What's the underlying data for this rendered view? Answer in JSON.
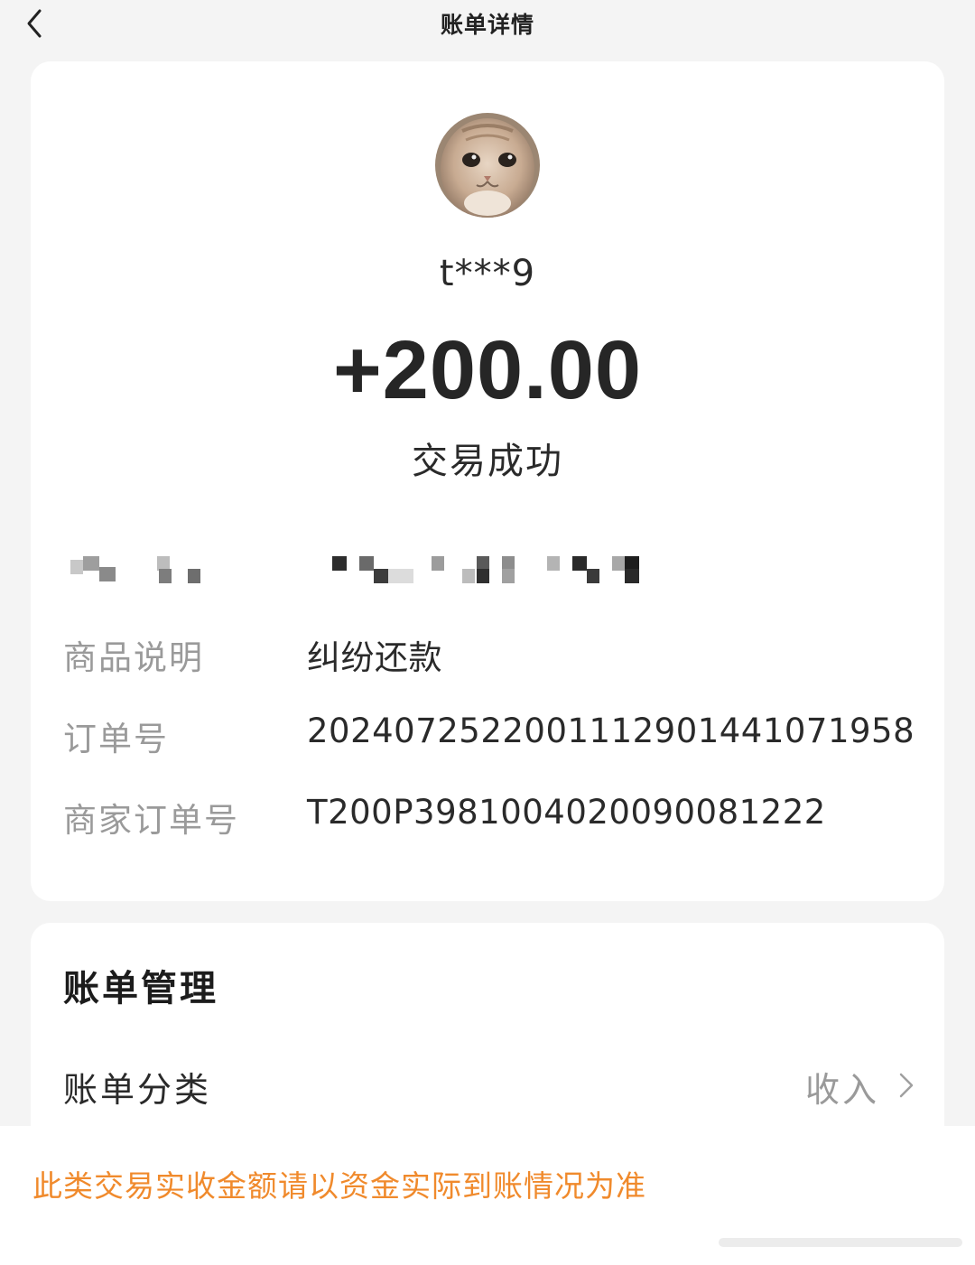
{
  "nav": {
    "title": "账单详情",
    "back_icon": "chevron-left-icon"
  },
  "payment": {
    "payer_name": "t***9",
    "amount": "+200.00",
    "status": "交易成功"
  },
  "details": [
    {
      "label": "商品说明",
      "value": "纠纷还款"
    },
    {
      "label": "订单号",
      "value": "2024072522001112901441071958"
    },
    {
      "label": "商家订单号",
      "value": "T200P3981004020090081222"
    }
  ],
  "bill_management": {
    "title": "账单管理",
    "category_label": "账单分类",
    "category_value": "收入",
    "chevron_icon": "chevron-right-icon"
  },
  "notice": {
    "text": "此类交易实收金额请以资金实际到账情况为准",
    "color": "#f08a2c"
  }
}
